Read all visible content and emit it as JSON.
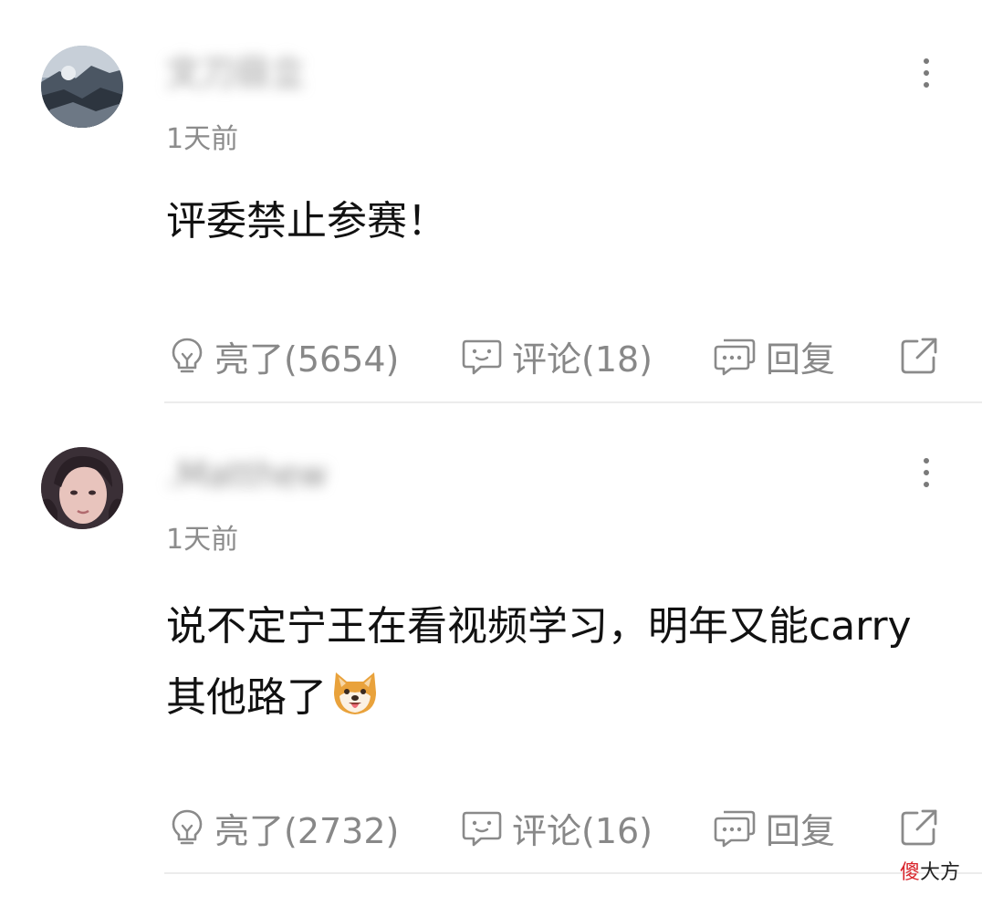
{
  "comments": [
    {
      "username": "文刀目立",
      "time": "1天前",
      "text": "评委禁止参赛！",
      "actions": {
        "like": "亮了(5654)",
        "comment": "评论(18)",
        "reply": "回复"
      },
      "avatar_icon": "avatar-landscape-icon"
    },
    {
      "username": ".Matthew",
      "time": "1天前",
      "text": "说不定宁王在看视频学习，明年又能carry其他路了",
      "actions": {
        "like": "亮了(2732)",
        "comment": "评论(16)",
        "reply": "回复"
      },
      "emoji": "shiba-dog-emoji",
      "avatar_icon": "avatar-girl-icon"
    }
  ],
  "watermark": {
    "red": "傻",
    "black": "大方"
  },
  "colors": {
    "text": "#111111",
    "muted": "#888888",
    "divider": "#ececec",
    "watermark_red": "#d8232a"
  }
}
